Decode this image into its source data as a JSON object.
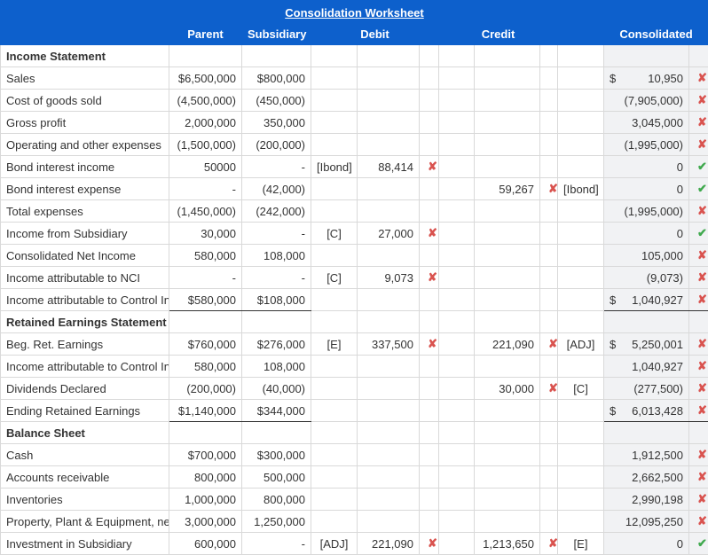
{
  "title": "Consolidation Worksheet",
  "columns": {
    "parent": "Parent",
    "subsidiary": "Subsidiary",
    "debit": "Debit",
    "credit": "Credit",
    "consolidated": "Consolidated"
  },
  "sections": {
    "income": "Income Statement",
    "retained": "Retained Earnings Statement",
    "balance": "Balance Sheet"
  },
  "marks": {
    "wrong": "✘",
    "correct": "✔"
  },
  "dollar": "$",
  "rows": [
    {
      "sec": "income",
      "label": "Sales",
      "parent": "$6,500,000",
      "sub": "$800,000",
      "cons": "10,950",
      "consMark": "wrong",
      "consCur": true
    },
    {
      "sec": "income",
      "label": "Cost of goods sold",
      "parent": "(4,500,000)",
      "sub": "(450,000)",
      "cons": "(7,905,000)",
      "consMark": "wrong"
    },
    {
      "sec": "income",
      "label": "Gross profit",
      "parent": "2,000,000",
      "sub": "350,000",
      "parentTop": true,
      "subTop": true,
      "cons": "3,045,000",
      "consMark": "wrong",
      "consTop": true
    },
    {
      "sec": "income",
      "label": "Operating and other expenses",
      "parent": "(1,500,000)",
      "sub": "(200,000)",
      "cons": "(1,995,000)",
      "consMark": "wrong"
    },
    {
      "sec": "income",
      "label": "Bond interest income",
      "parent": "50000",
      "sub": "-",
      "debitRef": "[Ibond]",
      "debit": "88,414",
      "debitMark": "wrong",
      "cons": "0",
      "consMark": "correct"
    },
    {
      "sec": "income",
      "label": "Bond interest expense",
      "parent": "-",
      "sub": "(42,000)",
      "credit": "59,267",
      "creditMark": "wrong",
      "creditRef": "[Ibond]",
      "cons": "0",
      "consMark": "correct"
    },
    {
      "sec": "income",
      "label": "Total expenses",
      "parent": "(1,450,000)",
      "sub": "(242,000)",
      "parentTop": true,
      "subTop": true,
      "cons": "(1,995,000)",
      "consMark": "wrong",
      "consTop": true
    },
    {
      "sec": "income",
      "label": "Income from Subsidiary",
      "parent": "30,000",
      "sub": "-",
      "debitRef": "[C]",
      "debit": "27,000",
      "debitMark": "wrong",
      "cons": "0",
      "consMark": "correct"
    },
    {
      "sec": "income",
      "label": "Consolidated Net Income",
      "parent": "580,000",
      "sub": "108,000",
      "parentTop": true,
      "subTop": true,
      "cons": "105,000",
      "consMark": "wrong",
      "consTop": true
    },
    {
      "sec": "income",
      "label": "Income attributable to NCI",
      "parent": "-",
      "sub": "-",
      "debitRef": "[C]",
      "debit": "9,073",
      "debitMark": "wrong",
      "cons": "(9,073)",
      "consMark": "wrong"
    },
    {
      "sec": "income",
      "label": "Income attributable to Control Int",
      "parent": "$580,000",
      "sub": "$108,000",
      "parentTop": true,
      "parentBot": true,
      "subTop": true,
      "subBot": true,
      "cons": "1,040,927",
      "consMark": "wrong",
      "consTop": true,
      "consBot": true,
      "consCur": true
    },
    {
      "sec": "retained",
      "label": "Beg. Ret. Earnings",
      "parent": "$760,000",
      "sub": "$276,000",
      "debitRef": "[E]",
      "debit": "337,500",
      "debitMark": "wrong",
      "credit": "221,090",
      "creditMark": "wrong",
      "creditRef": "[ADJ]",
      "cons": "5,250,001",
      "consMark": "wrong",
      "consCur": true
    },
    {
      "sec": "retained",
      "label": "Income attributable to Control Int",
      "parent": "580,000",
      "sub": "108,000",
      "cons": "1,040,927",
      "consMark": "wrong"
    },
    {
      "sec": "retained",
      "label": "Dividends Declared",
      "parent": "(200,000)",
      "sub": "(40,000)",
      "credit": "30,000",
      "creditMark": "wrong",
      "creditRef": "[C]",
      "cons": "(277,500)",
      "consMark": "wrong"
    },
    {
      "sec": "retained",
      "label": "Ending Retained Earnings",
      "parent": "$1,140,000",
      "sub": "$344,000",
      "parentTop": true,
      "parentBot": true,
      "subTop": true,
      "subBot": true,
      "cons": "6,013,428",
      "consMark": "wrong",
      "consTop": true,
      "consBot": true,
      "consCur": true
    },
    {
      "sec": "balance",
      "label": "Cash",
      "parent": "$700,000",
      "sub": "$300,000",
      "cons": "1,912,500",
      "consMark": "wrong"
    },
    {
      "sec": "balance",
      "label": "Accounts receivable",
      "parent": "800,000",
      "sub": "500,000",
      "cons": "2,662,500",
      "consMark": "wrong"
    },
    {
      "sec": "balance",
      "label": "Inventories",
      "parent": "1,000,000",
      "sub": "800,000",
      "cons": "2,990,198",
      "consMark": "wrong"
    },
    {
      "sec": "balance",
      "label": "Property, Plant & Equipment, net",
      "parent": "3,000,000",
      "sub": "1,250,000",
      "cons": "12,095,250",
      "consMark": "wrong"
    },
    {
      "sec": "balance",
      "label": "Investment in Subsidiary",
      "parent": "600,000",
      "sub": "-",
      "debitRef": "[ADJ]",
      "debit": "221,090",
      "debitMark": "wrong",
      "credit": "1,213,650",
      "creditMark": "wrong",
      "creditRef": "[E]",
      "cons": "0",
      "consMark": "correct"
    }
  ]
}
